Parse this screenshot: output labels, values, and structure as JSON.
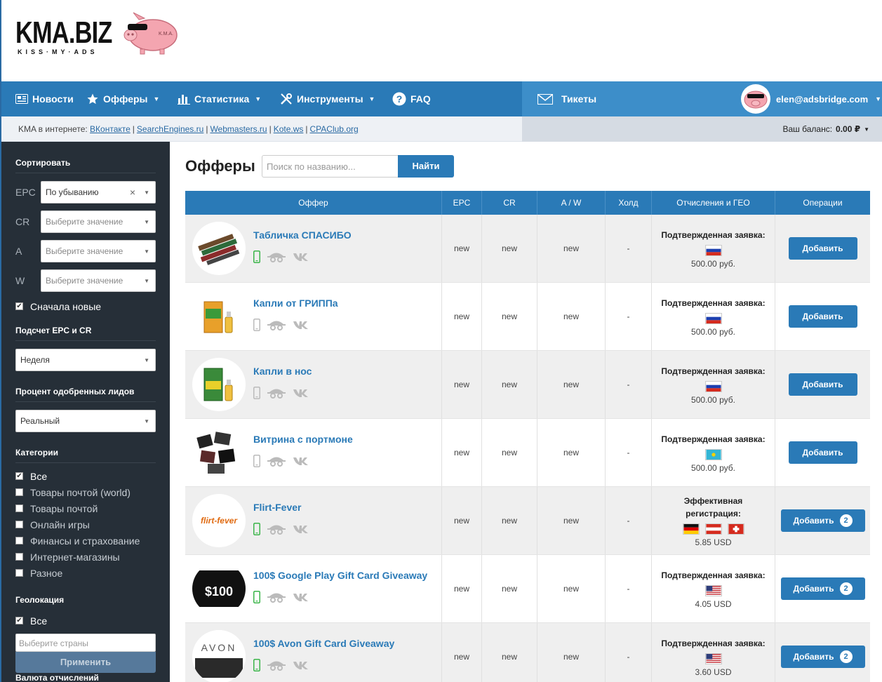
{
  "logo": {
    "text": "KMA.BIZ",
    "sub": "KISS·MY·ADS",
    "pig_tag": "K.M.A."
  },
  "nav": {
    "items": [
      {
        "label": "Новости",
        "icon": "news-icon"
      },
      {
        "label": "Офферы",
        "icon": "star-icon"
      },
      {
        "label": "Статистика",
        "icon": "bar-chart-icon"
      },
      {
        "label": "Инструменты",
        "icon": "tools-icon"
      },
      {
        "label": "FAQ",
        "icon": "question-icon"
      }
    ],
    "tickets": "Тикеты",
    "user_email": "elen@adsbridge.com"
  },
  "subbar": {
    "prefix": "KMA в интернете:",
    "links": [
      "ВКонтакте",
      "SearchEngines.ru",
      "Webmasters.ru",
      "Kote.ws",
      "CPAClub.org"
    ],
    "balance_label": "Ваш баланс:",
    "balance_value": "0.00 ₽"
  },
  "sidebar": {
    "sort_title": "Сортировать",
    "sort_rows": [
      {
        "label": "EPC",
        "value": "По убыванию"
      },
      {
        "label": "CR",
        "value": "Выберите значение"
      },
      {
        "label": "A",
        "value": "Выберите значение"
      },
      {
        "label": "W",
        "value": "Выберите значение"
      }
    ],
    "newest_first": "Сначала новые",
    "epc_title": "Подсчет EPC и CR",
    "epc_value": "Неделя",
    "approve_title": "Процент одобренных лидов",
    "approve_value": "Реальный",
    "cat_title": "Категории",
    "categories": [
      {
        "label": "Все",
        "checked": true
      },
      {
        "label": "Товары почтой (world)",
        "checked": false
      },
      {
        "label": "Товары почтой",
        "checked": false
      },
      {
        "label": "Онлайн игры",
        "checked": false
      },
      {
        "label": "Финансы и страхование",
        "checked": false
      },
      {
        "label": "Интернет-магазины",
        "checked": false
      },
      {
        "label": "Разное",
        "checked": false
      }
    ],
    "geo_title": "Геолокация",
    "geo_all": "Все",
    "geo_placeholder": "Выберите страны",
    "apply": "Применить",
    "currency_title": "Валюта отчислений"
  },
  "main": {
    "title": "Офферы",
    "search_placeholder": "Поиск по названию...",
    "search_button": "Найти",
    "columns": [
      "Оффер",
      "EPC",
      "CR",
      "A / W",
      "Холд",
      "Отчисления и ГЕО",
      "Операции"
    ]
  },
  "offers": [
    {
      "name": "Табличка СПАСИБО",
      "epc": "new",
      "cr": "new",
      "aw": "new",
      "hold": "-",
      "geo": "Подтвержденная заявка:",
      "flags": [
        "ru"
      ],
      "amount": "500.00 руб.",
      "button": "Добавить",
      "lock": false,
      "mobile": true,
      "thumb": "plates"
    },
    {
      "name": "Капли от ГРИППа",
      "epc": "new",
      "cr": "new",
      "aw": "new",
      "hold": "-",
      "geo": "Подтвержденная заявка:",
      "flags": [
        "ru"
      ],
      "amount": "500.00 руб.",
      "button": "Добавить",
      "lock": false,
      "mobile": false,
      "thumb": "bottle-orange"
    },
    {
      "name": "Капли в нос",
      "epc": "new",
      "cr": "new",
      "aw": "new",
      "hold": "-",
      "geo": "Подтвержденная заявка:",
      "flags": [
        "ru"
      ],
      "amount": "500.00 руб.",
      "button": "Добавить",
      "lock": false,
      "mobile": false,
      "thumb": "bottle-green"
    },
    {
      "name": "Витрина с портмоне",
      "epc": "new",
      "cr": "new",
      "aw": "new",
      "hold": "-",
      "geo": "Подтвержденная заявка:",
      "flags": [
        "kz"
      ],
      "amount": "500.00 руб.",
      "button": "Добавить",
      "lock": false,
      "mobile": false,
      "thumb": "wallets"
    },
    {
      "name": "Flirt-Fever",
      "epc": "new",
      "cr": "new",
      "aw": "new",
      "hold": "-",
      "geo": "Эффективная регистрация:",
      "flags": [
        "de",
        "at",
        "ch"
      ],
      "amount": "5.85 USD",
      "button": "Добавить",
      "lock": true,
      "mobile": true,
      "thumb": "flirt",
      "thumb_text": "flirt-fever"
    },
    {
      "name": "100$ Google Play Gift Card Giveaway",
      "epc": "new",
      "cr": "new",
      "aw": "new",
      "hold": "-",
      "geo": "Подтвержденная заявка:",
      "flags": [
        "us"
      ],
      "amount": "4.05 USD",
      "button": "Добавить",
      "lock": true,
      "mobile": true,
      "thumb": "gplay",
      "thumb_text": "$100"
    },
    {
      "name": "100$ Avon Gift Card Giveaway",
      "epc": "new",
      "cr": "new",
      "aw": "new",
      "hold": "-",
      "geo": "Подтвержденная заявка:",
      "flags": [
        "us"
      ],
      "amount": "3.60 USD",
      "button": "Добавить",
      "lock": true,
      "mobile": true,
      "thumb": "avon",
      "thumb_text": "AVON"
    }
  ],
  "colors": {
    "primary": "#2a7ab7",
    "nav_right": "#3d8ec9",
    "sidebar": "#262f38",
    "mobile_green": "#3bb54a"
  }
}
